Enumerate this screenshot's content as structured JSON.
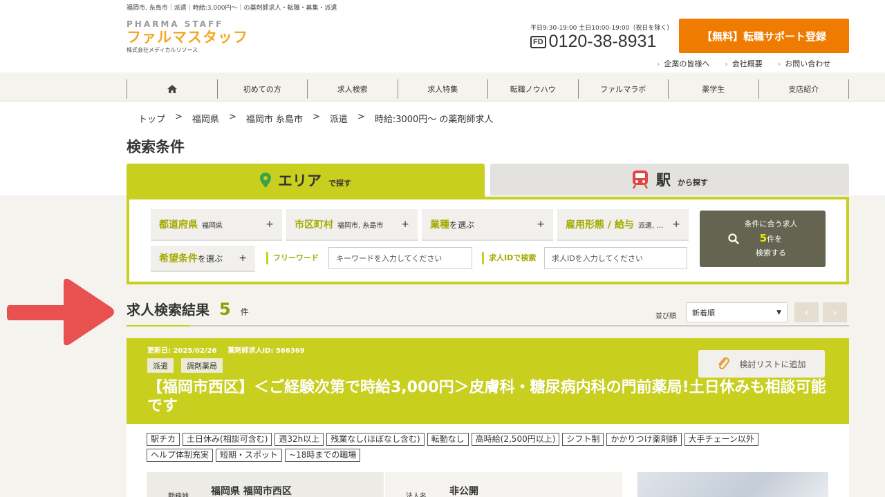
{
  "header": {
    "seo_line": "福岡市, 糸島市｜派遣｜時給:3,000円〜｜の薬剤師求人・転職・募集・派遣",
    "logo_en": "PHARMA STAFF",
    "logo_jp": "ファルマスタッフ",
    "company": "株式会社メディカルリソース",
    "hours": "平日9:30-19:00 土日10:00-19:00（祝日を除く）",
    "phone_mark": "FD",
    "phone": "0120-38-8931",
    "register_button": "【無料】転職サポート登録",
    "sublinks": [
      "企業の皆様へ",
      "会社概要",
      "お問い合わせ"
    ]
  },
  "nav": {
    "home_icon": "home-icon",
    "items": [
      "初めての方",
      "求人検索",
      "求人特集",
      "転職ノウハウ",
      "ファルマラボ",
      "薬学生",
      "支店紹介"
    ]
  },
  "breadcrumb": {
    "items": [
      "トップ",
      "福岡県",
      "福岡市 糸島市",
      "派遣",
      "時給:3000円〜 の薬剤師求人"
    ],
    "separator": ">"
  },
  "search": {
    "title": "検索条件",
    "tab_area_big": "エリア",
    "tab_area_small": "で探す",
    "tab_station_big": "駅",
    "tab_station_small": "から探す",
    "pref_label": "都道府県",
    "pref_value": "福岡県",
    "city_label": "市区町村",
    "city_value": "福岡市, 糸島市",
    "industry_label": "業種",
    "industry_suffix": "を選ぶ",
    "employment_label": "雇用形態 / 給与",
    "employment_value": "派遣, …",
    "wish_label": "希望条件",
    "wish_suffix": "を選ぶ",
    "plus": "+",
    "freeword_label": "フリーワード",
    "freeword_placeholder": "キーワードを入力してください",
    "jobid_label": "求人IDで検索",
    "jobid_placeholder": "求人IDを入力してください",
    "go_line1": "条件に合う求人",
    "go_count": "5",
    "go_line2": "件を",
    "go_line3": "検索する"
  },
  "results": {
    "title": "求人検索結果",
    "count": "5",
    "unit": "件",
    "sort_label": "並び順",
    "sort_value": "新着順",
    "prev": "‹",
    "next": "›"
  },
  "job": {
    "updated": "更新日: 2025/02/26",
    "job_id": "薬剤師求人ID: 566369",
    "tags": [
      "派遣",
      "調剤薬局"
    ],
    "title": "【福岡市西区】＜ご経験次第で時給3,000円＞皮膚科・糖尿病内科の門前薬局!土日休みも相談可能です",
    "fav_button": "検討リストに追加",
    "features": [
      "駅チカ",
      "土日休み(相談可含む)",
      "週32h以上",
      "残業なし(ほぼなし含む)",
      "転勤なし",
      "高時給(2,500円以上)",
      "シフト制",
      "かかりつけ薬剤師",
      "大手チェーン以外",
      "ヘルプ体制充実",
      "短期・スポット",
      "~18時までの職場"
    ],
    "location_key": "勤務地",
    "location_value": "福岡県 福岡市西区",
    "corp_key": "法人名",
    "corp_value": "非公開"
  },
  "colors": {
    "accent": "#c8cf1e",
    "orange": "#ef7c00",
    "arrow": "#e8514f",
    "dark_button": "#646450"
  }
}
